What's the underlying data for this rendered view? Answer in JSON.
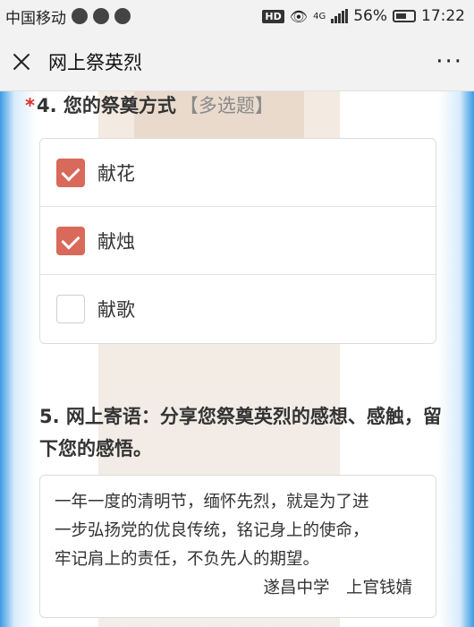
{
  "status_bar": {
    "carrier": "中国移动",
    "hd": "HD",
    "network": "4G",
    "battery": "56%",
    "time": "17:22"
  },
  "nav": {
    "title": "网上祭英烈",
    "more": "···"
  },
  "question4": {
    "required_mark": "*",
    "title": "4. 您的祭奠方式",
    "type": "【多选题】",
    "options": [
      {
        "label": "献花",
        "checked": true
      },
      {
        "label": "献烛",
        "checked": true
      },
      {
        "label": "献歌",
        "checked": false
      }
    ]
  },
  "question5": {
    "title": "5. 网上寄语：分享您祭奠英烈的感想、感触，留下您的感悟。",
    "answer_lines": [
      "一年一度的清明节，缅怀先烈，就是为了进",
      "一步弘扬党的优良传统，铭记身上的使命，",
      "牢记肩上的责任，不负先人的期望。"
    ],
    "signature": "遂昌中学　上官钱婧"
  },
  "colors": {
    "checked": "#d9695a",
    "required": "#d9302b",
    "side_blue": "#3b9be6"
  }
}
